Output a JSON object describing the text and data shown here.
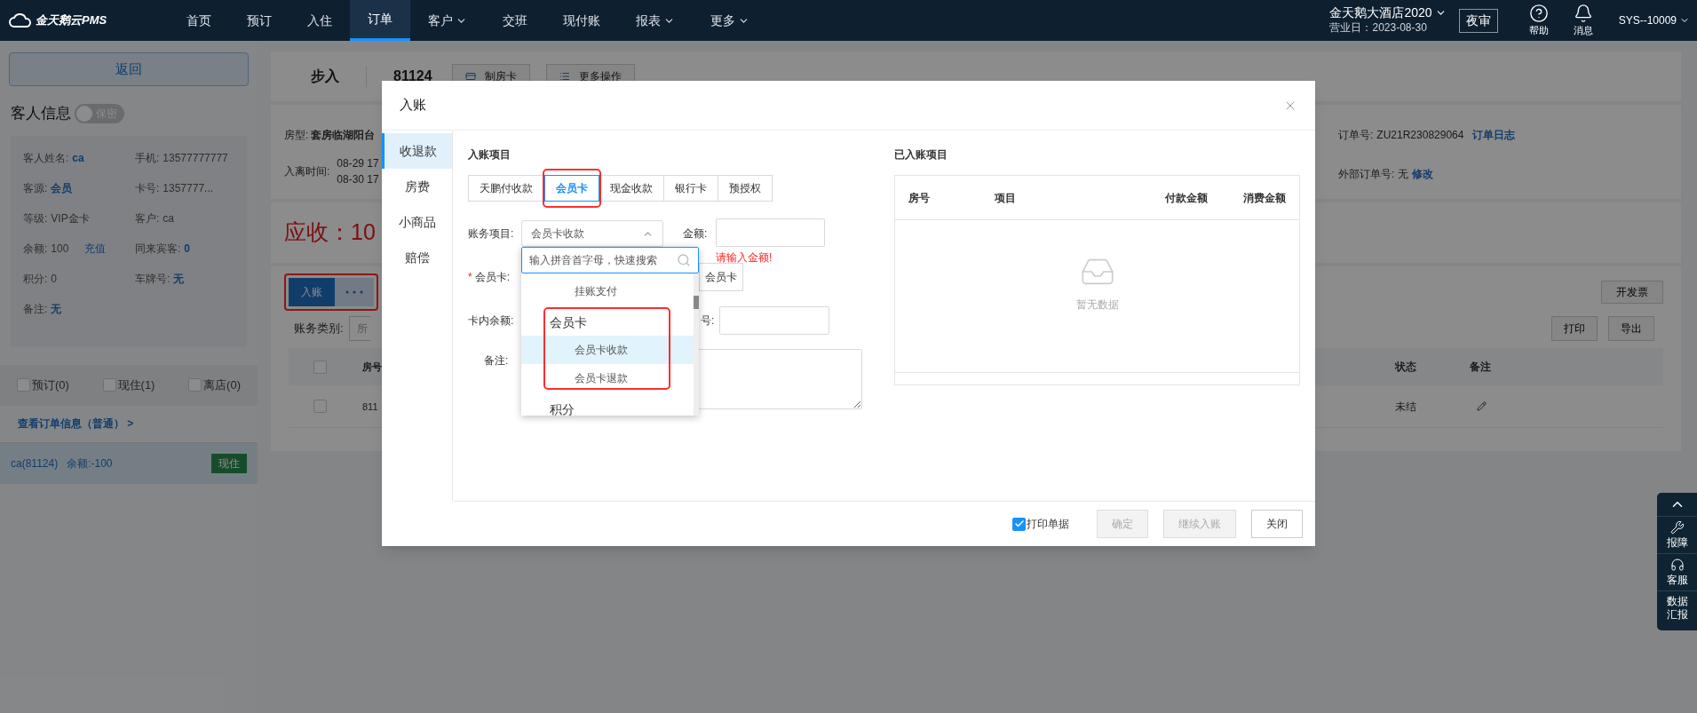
{
  "topbar": {
    "logo": "金天鹅云PMS",
    "nav": [
      {
        "label": "首页",
        "selected": false,
        "dropdown": false
      },
      {
        "label": "预订",
        "selected": false,
        "dropdown": false
      },
      {
        "label": "入住",
        "selected": false,
        "dropdown": false
      },
      {
        "label": "订单",
        "selected": true,
        "dropdown": false
      },
      {
        "label": "客户",
        "selected": false,
        "dropdown": true
      },
      {
        "label": "交班",
        "selected": false,
        "dropdown": false
      },
      {
        "label": "现付账",
        "selected": false,
        "dropdown": false
      },
      {
        "label": "报表",
        "selected": false,
        "dropdown": true
      },
      {
        "label": "更多",
        "selected": false,
        "dropdown": true
      }
    ],
    "hotel": "金天鹅大酒店2020",
    "business_date": "营业日：2023-08-30",
    "night_audit": "夜审",
    "help": "帮助",
    "messages": "消息",
    "user": "SYS--10009"
  },
  "sidebar": {
    "back": "返回",
    "guest_title": "客人信息",
    "privacy_toggle": {
      "label": "保密",
      "on": false
    },
    "guest_fields": [
      {
        "label": "客人姓名:",
        "value": "ca",
        "link": true
      },
      {
        "label": "手机:",
        "value": "13577777777",
        "link": false
      },
      {
        "label": "客源:",
        "value": "会员",
        "link": true
      },
      {
        "label": "卡号:",
        "value": "1357777...",
        "link": false
      },
      {
        "label": "等级:",
        "value": "VIP金卡",
        "link": false
      },
      {
        "label": "客户:",
        "value": "ca",
        "link": false
      },
      {
        "label": "余额:",
        "value": "100",
        "link": false,
        "action": "充值"
      },
      {
        "label": "同来宾客:",
        "value": "0",
        "link": true
      },
      {
        "label": "积分:",
        "value": "0",
        "link": false
      },
      {
        "label": "车牌号:",
        "value": "无",
        "link": true
      },
      {
        "label": "备注:",
        "value": "无",
        "link": true
      }
    ],
    "filters": [
      {
        "label": "预订(0)",
        "checked": false
      },
      {
        "label": "现住(1)",
        "checked": false
      },
      {
        "label": "离店(0)",
        "checked": false
      }
    ],
    "order_link": "查看订单信息（普通） >",
    "rooms": [
      {
        "name": "ca(81124)",
        "balance": "余额:-100",
        "status": "现住",
        "selected": true
      }
    ]
  },
  "order": {
    "type": "步入",
    "room": "81124",
    "actions": [
      "制房卡",
      "更多操作"
    ],
    "room_type_label": "房型:",
    "room_type": "套房临湖阳台",
    "dates_label": "入离时间:",
    "dates": [
      "08-29 17",
      "08-30 17"
    ],
    "order_no_label": "订单号:",
    "order_no": "ZU21R230829064",
    "order_log": "订单日志",
    "external_label": "外部订单号:",
    "external": "无",
    "edit": "修改",
    "receivable": "应收：10"
  },
  "bills": {
    "post_button": "入账",
    "annotated": true,
    "invoice": "开发票",
    "category_label": "账务类别:",
    "category_value": "所",
    "select_all_checked": false,
    "print": "打印",
    "export": "导出",
    "columns": [
      "房号",
      "状态",
      "备注"
    ],
    "rows": [
      {
        "room": "811",
        "status": "未结",
        "checked": false
      }
    ]
  },
  "dialog": {
    "title": "入账",
    "nav": [
      {
        "label": "收退款",
        "selected": true
      },
      {
        "label": "房费",
        "selected": false
      },
      {
        "label": "小商品",
        "selected": false
      },
      {
        "label": "赔偿",
        "selected": false
      }
    ],
    "section_title": "入账项目",
    "payment_tabs": [
      {
        "label": "天鹏付收款",
        "selected": false,
        "annotated": false
      },
      {
        "label": "会员卡",
        "selected": true,
        "annotated": true
      },
      {
        "label": "现金收款",
        "selected": false,
        "annotated": false
      },
      {
        "label": "银行卡",
        "selected": false,
        "annotated": false
      },
      {
        "label": "预授权",
        "selected": false,
        "annotated": false
      }
    ],
    "account_label": "账务项目:",
    "account_value": "会员卡收款",
    "amount_label": "金额:",
    "amount_error": "请输入金额!",
    "card_label": "会员卡:",
    "required_mark": "*",
    "card_button": "会员卡",
    "balance_label": "卡内余额:",
    "number_label": "号:",
    "remark_label": "备注:",
    "dropdown": {
      "search_placeholder": "输入拼音首字母，快速搜索",
      "items": [
        {
          "kind": "option",
          "label": "挂账支付",
          "selected": false
        },
        {
          "kind": "group",
          "label": "会员卡",
          "annotated": true,
          "children": [
            {
              "label": "会员卡收款",
              "selected": true
            },
            {
              "label": "会员卡退款",
              "selected": false
            }
          ]
        },
        {
          "kind": "group",
          "label": "积分",
          "annotated": false
        }
      ]
    },
    "posted": {
      "title": "已入账项目",
      "columns": [
        "房号",
        "项目",
        "付款金额",
        "消费金额"
      ],
      "empty": "暂无数据"
    },
    "print_receipt": {
      "label": "打印单据",
      "checked": true
    },
    "buttons": [
      {
        "label": "确定",
        "disabled": true
      },
      {
        "label": "继续入账",
        "disabled": true
      },
      {
        "label": "关闭",
        "disabled": false
      }
    ]
  },
  "float_tools": [
    "报障",
    "客服",
    "数据汇报"
  ]
}
